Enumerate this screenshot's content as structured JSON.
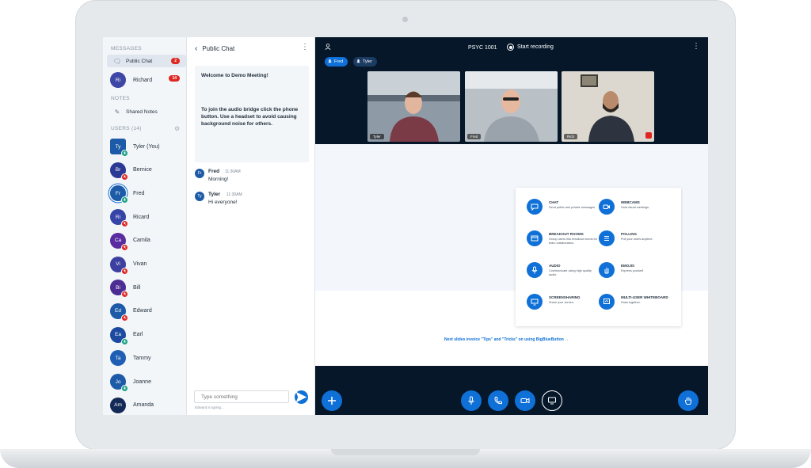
{
  "colors": {
    "brand": "#0f70d7",
    "danger": "#df2721",
    "success": "#18a183",
    "dark": "#06172a"
  },
  "sidebar": {
    "messages_title": "MESSAGES",
    "public_chat": {
      "label": "Public Chat",
      "badge": "2"
    },
    "richard": {
      "initials": "Ri",
      "name": "Richard",
      "badge": "14"
    },
    "notes_title": "NOTES",
    "shared_notes": "Shared Notes",
    "users_title": "USERS (14)",
    "users": [
      {
        "initials": "Ty",
        "name": "Tyler (You)",
        "color": "#1d5ba8",
        "mic": "on"
      },
      {
        "initials": "Br",
        "name": "Bernice",
        "color": "#2a3993",
        "mic": "muted"
      },
      {
        "initials": "Fr",
        "name": "Fred",
        "color": "#1d5ba8",
        "mic": "on"
      },
      {
        "initials": "Ri",
        "name": "Ricard",
        "color": "#3644a8",
        "mic": "muted"
      },
      {
        "initials": "Ca",
        "name": "Camila",
        "color": "#5a2ca0",
        "mic": "muted"
      },
      {
        "initials": "Vi",
        "name": "Vivan",
        "color": "#3a3fa0",
        "mic": "muted"
      },
      {
        "initials": "Bi",
        "name": "Bill",
        "color": "#4b2d94",
        "mic": "muted"
      },
      {
        "initials": "Ed",
        "name": "Edward",
        "color": "#1d5ba8",
        "mic": "muted"
      },
      {
        "initials": "Ea",
        "name": "Earl",
        "color": "#1c4aa0",
        "mic": "on"
      },
      {
        "initials": "Ta",
        "name": "Tammy",
        "color": "#1e5fb4",
        "mic": "none"
      },
      {
        "initials": "Jo",
        "name": "Joanne",
        "color": "#1d5ba8",
        "mic": "on"
      },
      {
        "initials": "Am",
        "name": "Amanda",
        "color": "#142a56",
        "mic": "none"
      }
    ]
  },
  "chat": {
    "title": "Public Chat",
    "welcome_line1": "Welcome to Demo Meeting!",
    "welcome_line2": "To join the audio bridge click the phone button. Use a headset to avoid causing background noise for others.",
    "messages": [
      {
        "initials": "Fr",
        "name": "Fred",
        "time": "11:30AM",
        "text": "Morning!",
        "color": "#1d5ba8"
      },
      {
        "initials": "Ty",
        "name": "Tyler",
        "time": "11:30AM",
        "text": "Hi everyone!",
        "color": "#1d5ba8"
      }
    ],
    "input_placeholder": "Type something",
    "typing": "Edward is typing..."
  },
  "meeting": {
    "title": "PSYC 1001",
    "record_label": "Start recording",
    "talkers": [
      "Fred",
      "Tyler"
    ],
    "tiles": [
      {
        "label": "Tyler"
      },
      {
        "label": "Fred"
      },
      {
        "label": "Rich"
      }
    ]
  },
  "slide": {
    "features": [
      {
        "title": "CHAT",
        "desc": "Send public and private messages."
      },
      {
        "title": "WEBCAMS",
        "desc": "Hold visual meetings."
      },
      {
        "title": "BREAKOUT ROOMS",
        "desc": "Group users into breakout rooms for team collaboration."
      },
      {
        "title": "POLLING",
        "desc": "Poll your users anytime."
      },
      {
        "title": "AUDIO",
        "desc": "Communicate using high quality audio."
      },
      {
        "title": "EMOJIS",
        "desc": "Express yourself."
      },
      {
        "title": "SCREENSHARING",
        "desc": "Share your screen."
      },
      {
        "title": "MULTI-USER WHITEBOARD",
        "desc": "Draw together."
      }
    ],
    "link": "Next slides invoice \"Tips\" and \"Tricks\" on using BigBlueButton →"
  }
}
